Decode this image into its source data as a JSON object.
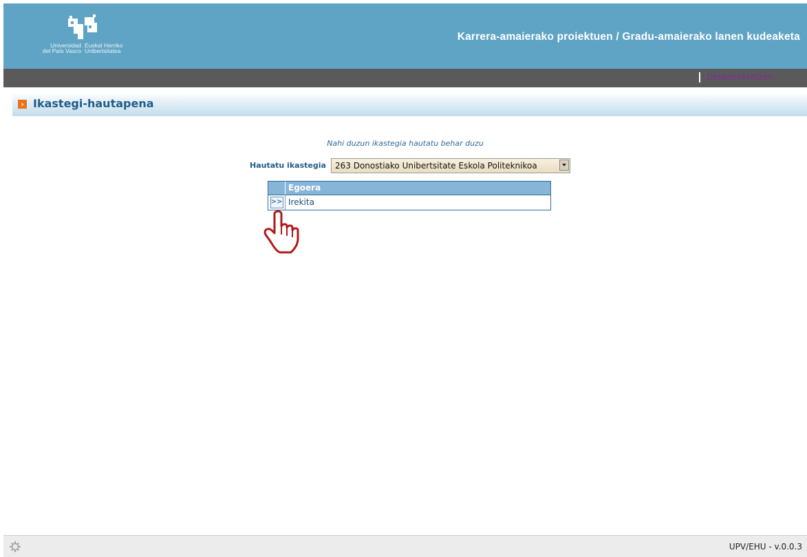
{
  "header": {
    "logo": {
      "crown_text": "",
      "left_line1": "Universidad",
      "left_line2": "del País Vasco",
      "right_line1": "Euskal Herriko",
      "right_line2": "Unibertsitatea"
    },
    "app_title": "Karrera-amaierako proiektuen / Gradu-amaierako lanen kudeaketa"
  },
  "toolbar": {
    "logout_label": "Deskonektatzen"
  },
  "section": {
    "title": "Ikastegi-hautapena"
  },
  "main": {
    "message": "Nahi duzun ikastegia hautatu behar duzu",
    "select_label": "Hautatu ikastegia",
    "select_value": "263 Donostiako Unibertsitate Eskola Politeknikoa",
    "table": {
      "header": "Egoera",
      "rows": [
        {
          "button": ">>",
          "status": "Irekita"
        }
      ]
    }
  },
  "footer": {
    "version": "UPV/EHU - v.0.0.3"
  },
  "colors": {
    "header_bg": "#5fa4c4",
    "toolbar_bg": "#5a5a5a",
    "logout_link": "#7d2e97",
    "section_title": "#215d8a",
    "section_arrow": "#e9731a",
    "table_header": "#87b5d8"
  },
  "icons": {
    "section_arrow": "chevron-right-icon",
    "cursor": "hand-pointer-icon",
    "footer": "gear-icon"
  }
}
